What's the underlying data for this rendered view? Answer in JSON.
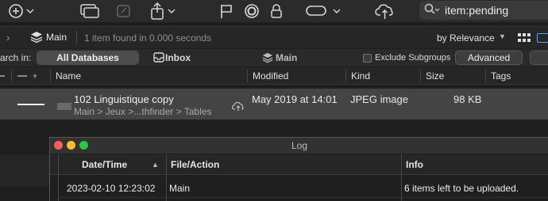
{
  "toolbar": {
    "icons": [
      "add-icon",
      "windows-icon",
      "edit-icon",
      "share-icon",
      "flag-icon",
      "circle-icon",
      "lock-icon",
      "toggle-icon",
      "cloud-upload-icon"
    ],
    "search": {
      "value": "item:pending"
    }
  },
  "pathbar": {
    "location": "Main",
    "status": "1 item found in 0.000 seconds",
    "sort": "by Relevance"
  },
  "scope": {
    "label": "arch in:",
    "all_databases": "All Databases",
    "inbox": "Inbox",
    "main": "Main",
    "exclude_subgroups": "Exclude Subgroups",
    "advanced": "Advanced"
  },
  "columns": {
    "name": "Name",
    "modified": "Modified",
    "kind": "Kind",
    "size": "Size",
    "tags": "Tags"
  },
  "results": [
    {
      "name": "102 Linguistique copy",
      "path": "Main > Jeux >...thfinder > Tables",
      "modified": "May 2019 at 14:01",
      "kind": "JPEG image",
      "size": "98 KB"
    }
  ],
  "log_window": {
    "title": "Log",
    "columns": {
      "datetime": "Date/Time",
      "file_action": "File/Action",
      "info": "Info"
    },
    "rows": [
      {
        "datetime": "2023-02-10 12:23:02",
        "file_action": "Main",
        "info": "6 items left to be uploaded."
      }
    ]
  }
}
